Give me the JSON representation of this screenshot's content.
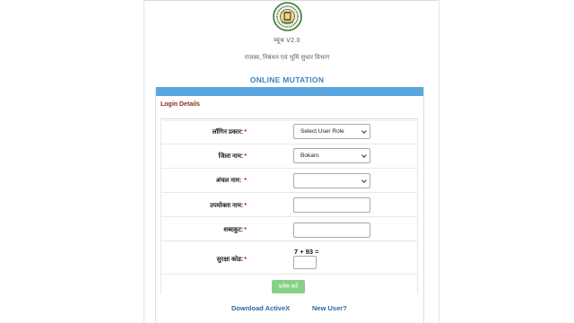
{
  "header": {
    "version": "म्यूथ V2.0",
    "department": "राजस्व, निबंधन एवं भूमि सुधार विभाग",
    "title": "ONLINE MUTATION"
  },
  "panel": {
    "title": "Login Details"
  },
  "form": {
    "login_type": {
      "label": "लॉगिन प्रकार:",
      "value": "Select User Role"
    },
    "district": {
      "label": "जिला नाम:",
      "value": "Bokaro"
    },
    "circle": {
      "label": "अंचल नाम: ",
      "value": ""
    },
    "username": {
      "label": "उपयोक्ता नाम:",
      "value": ""
    },
    "password": {
      "label": "शब्दकूट:",
      "value": ""
    },
    "captcha": {
      "label": "सुरक्षा कोड:",
      "question": "7 + 93 =",
      "value": ""
    },
    "required_mark": "*",
    "login_button": "प्रवेश करें"
  },
  "links": {
    "download": "Download ActiveX",
    "new_user": "New User?"
  },
  "colors": {
    "accent": "#5aa6de",
    "title": "#3b84c4",
    "panel_title": "#8b2a1a",
    "button": "#88cf88",
    "link": "#2f65a6",
    "required": "#d11111"
  },
  "icons": {
    "emblem": "jharkhand-emblem-icon",
    "dropdown": "chevron-down-icon"
  }
}
